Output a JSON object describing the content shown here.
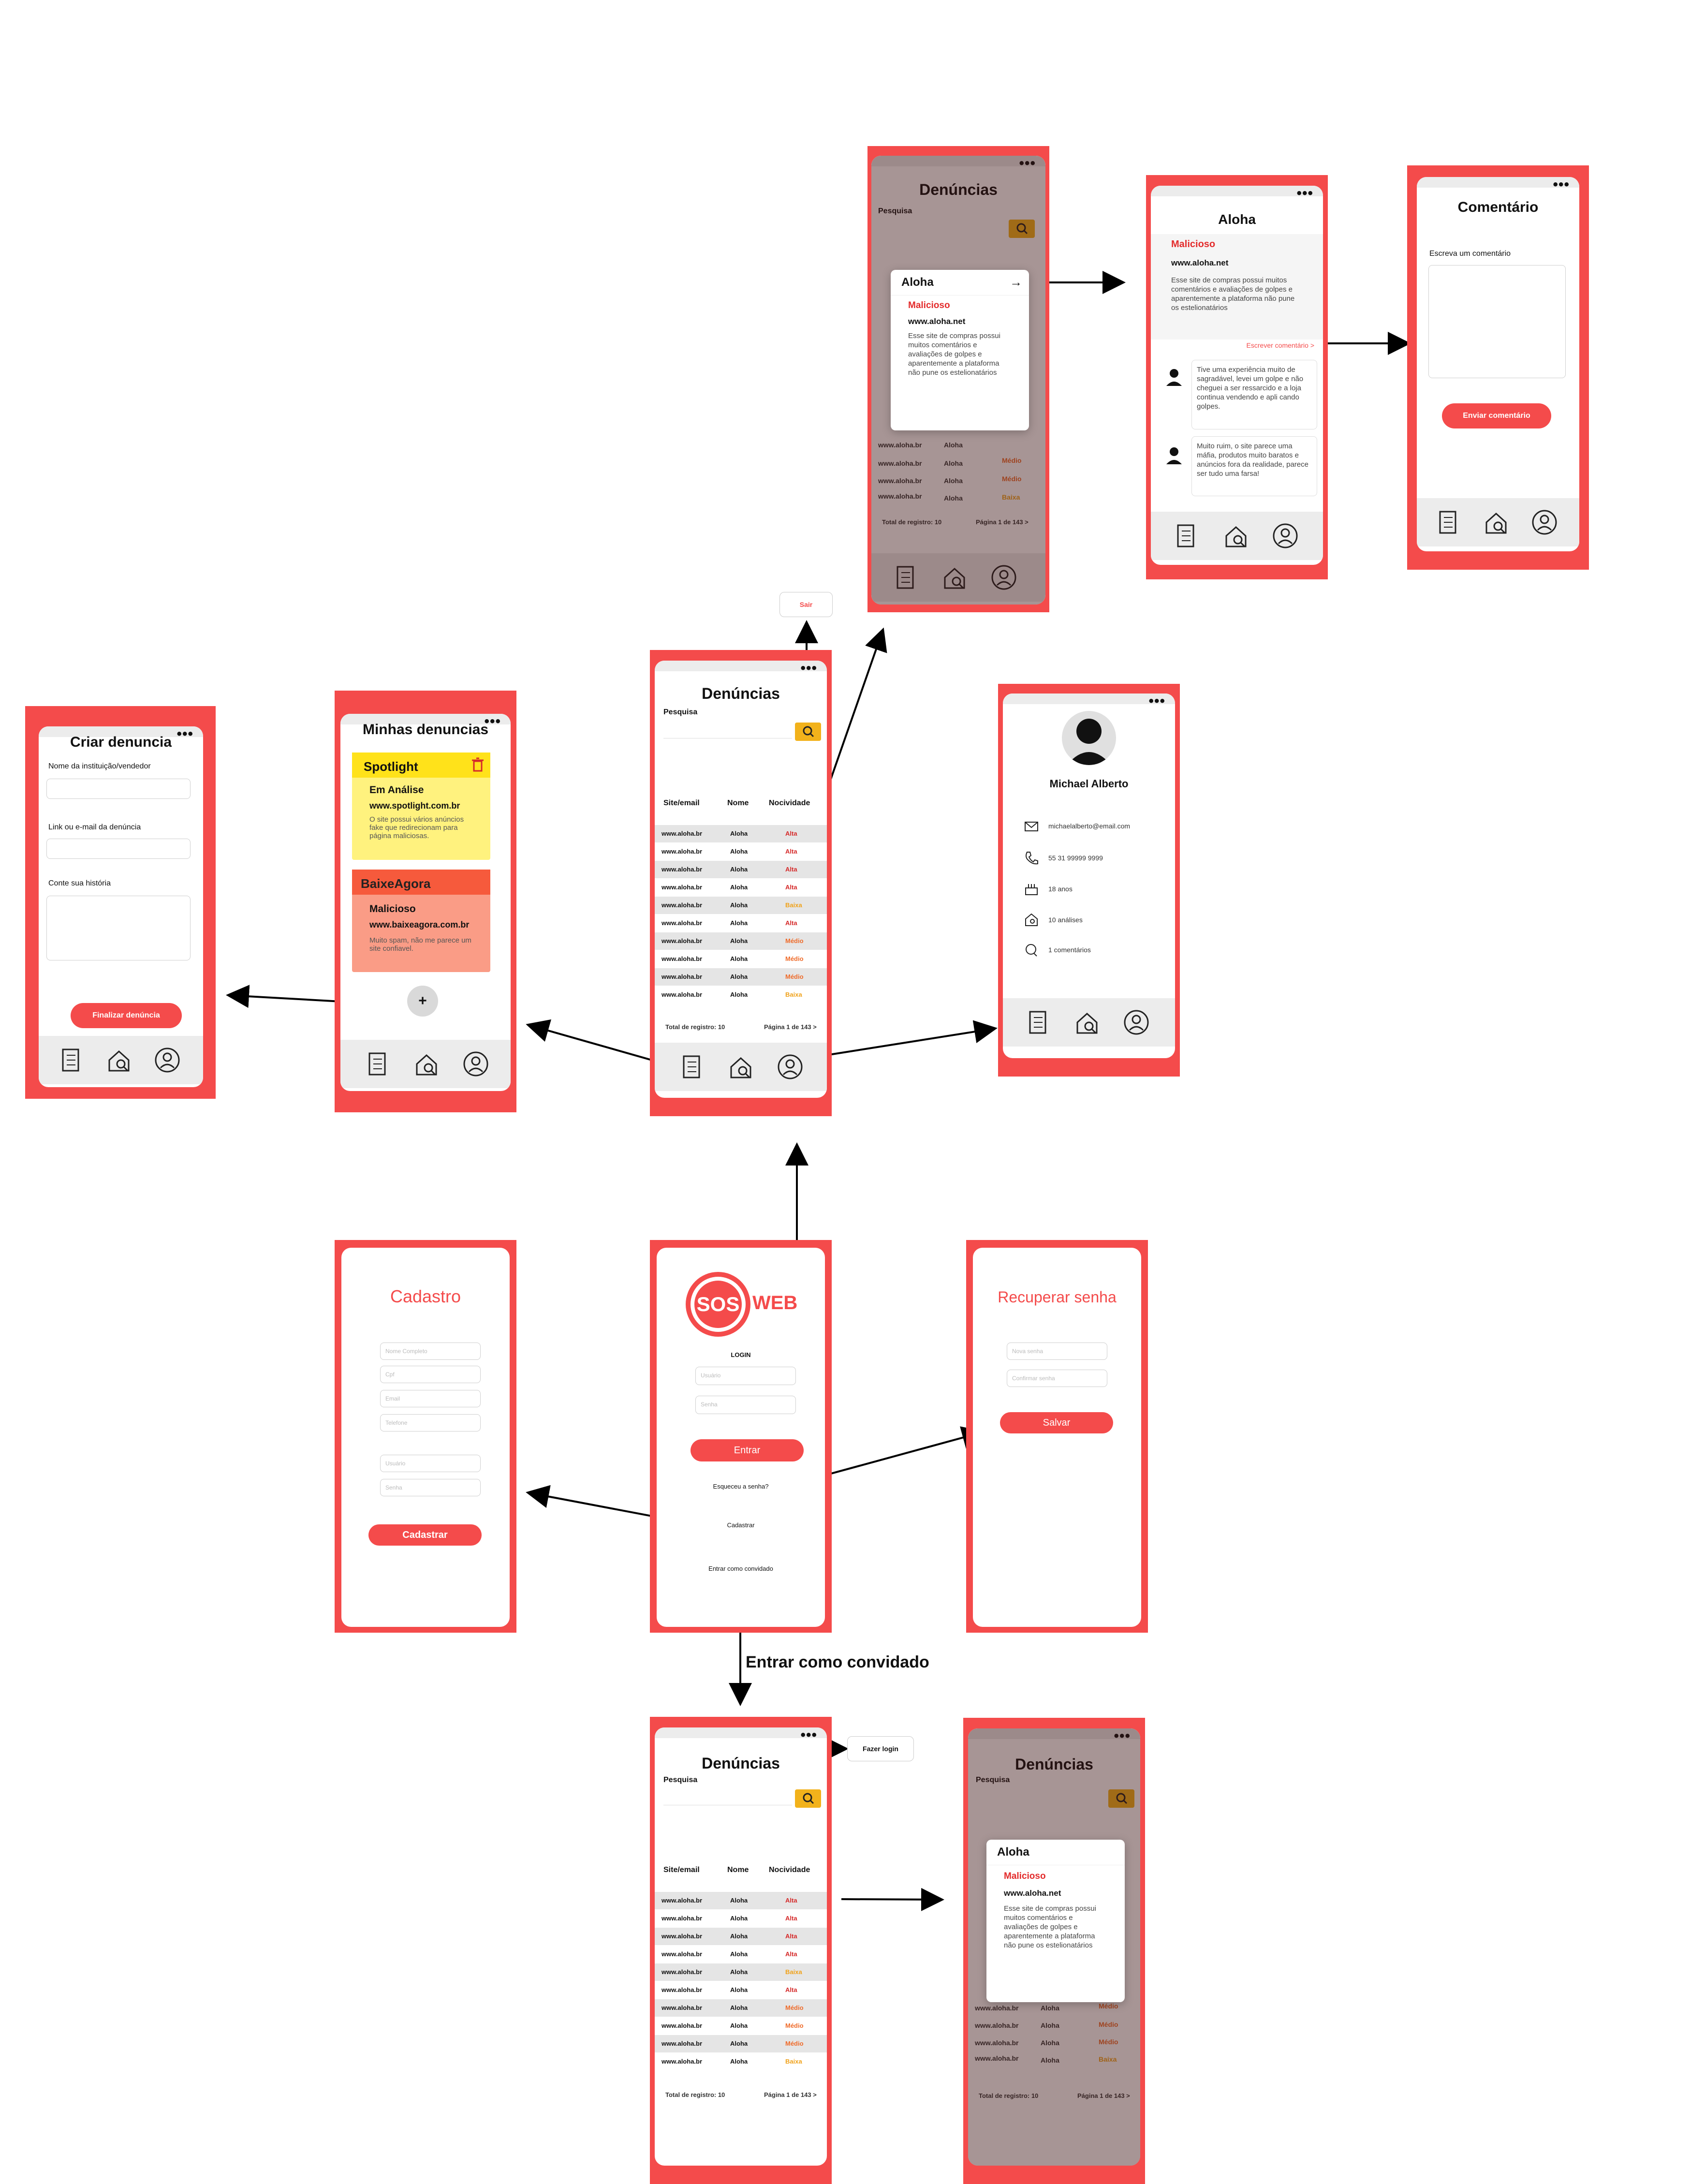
{
  "colors": {
    "brand_red": "#f44b4b",
    "search_yellow": "#f2b21b",
    "alta": "#d52a2a",
    "medio": "#ef6b2a",
    "baixa": "#f0a21b"
  },
  "denuncias": {
    "title": "Denúncias",
    "search_label": "Pesquisa",
    "columns": [
      "Site/email",
      "Nome",
      "Nocividade"
    ],
    "rows": [
      {
        "site": "www.aloha.br",
        "nome": "Aloha",
        "nivel": "Alta"
      },
      {
        "site": "www.aloha.br",
        "nome": "Aloha",
        "nivel": "Alta"
      },
      {
        "site": "www.aloha.br",
        "nome": "Aloha",
        "nivel": "Alta"
      },
      {
        "site": "www.aloha.br",
        "nome": "Aloha",
        "nivel": "Alta"
      },
      {
        "site": "www.aloha.br",
        "nome": "Aloha",
        "nivel": "Baixa"
      },
      {
        "site": "www.aloha.br",
        "nome": "Aloha",
        "nivel": "Alta"
      },
      {
        "site": "www.aloha.br",
        "nome": "Aloha",
        "nivel": "Médio"
      },
      {
        "site": "www.aloha.br",
        "nome": "Aloha",
        "nivel": "Médio"
      },
      {
        "site": "www.aloha.br",
        "nome": "Aloha",
        "nivel": "Médio"
      },
      {
        "site": "www.aloha.br",
        "nome": "Aloha",
        "nivel": "Baixa"
      }
    ],
    "total": "Total de registro: 10",
    "pagina": "Página 1 de 143  >"
  },
  "popup": {
    "title": "Aloha",
    "tag": "Malicioso",
    "site": "www.aloha.net",
    "desc": "Esse site de compras possui muitos comentários e avaliações de golpes e aparentemente a plataforma não pune os estelionatários"
  },
  "detalhe": {
    "title": "Aloha",
    "tag": "Malicioso",
    "site": "www.aloha.net",
    "desc": "Esse site de compras possui muitos comentários e avaliações de golpes e aparentemente a plataforma não pune os estelionatários",
    "escrever": "Escrever comentário >",
    "comments": [
      "Tive uma experiência muito de sagradável, levei um golpe e não cheguei a ser ressarcido e a loja continua vendendo e apli cando golpes.",
      "Muito ruim, o site parece uma máfia, produtos muito baratos e anúncios fora da realidade, parece ser tudo uma farsa!"
    ]
  },
  "comentario": {
    "title": "Comentário",
    "label": "Escreva um comentário",
    "button": "Enviar comentário"
  },
  "sair": "Sair",
  "perfil": {
    "name": "Michael Alberto",
    "email": "michaelalberto@email.com",
    "phone": "55 31 99999 9999",
    "age": "18 anos",
    "analises": "10 análises",
    "comentarios": "1 comentários"
  },
  "minhas": {
    "title": "Minhas denuncias",
    "cards": [
      {
        "name": "Spotlight",
        "status": "Em Análise",
        "site": "www.spotlight.com.br",
        "desc": "O site possui vários anúncios fake que redirecionam para página maliciosas."
      },
      {
        "name": "BaixeAgora",
        "status": "Malicioso",
        "site": "www.baixeagora.com.br",
        "desc": "Muito spam, não me parece um site confiavel."
      }
    ],
    "add": "+"
  },
  "criar": {
    "title": "Criar denuncia",
    "f1": "Nome da instituição/vendedor",
    "f2": "Link ou e-mail da denúncia",
    "f3": "Conte sua história",
    "button": "Finalizar denúncia"
  },
  "login": {
    "logo_sos": "SOS",
    "logo_web": "WEB",
    "label": "LOGIN",
    "user_ph": "Usuário",
    "pass_ph": "Senha",
    "button": "Entrar",
    "forgot": "Esqueceu a senha?",
    "register": "Cadastrar",
    "guest": "Entrar como convidado"
  },
  "cadastro": {
    "title": "Cadastro",
    "fields": [
      "Nome Completo",
      "Cpf",
      "Email",
      "Telefone",
      "Usuário",
      "Senha"
    ],
    "button": "Cadastrar"
  },
  "recuperar": {
    "title": "Recuperar senha",
    "fields": [
      "Nova senha",
      "Confirmar senha"
    ],
    "button": "Salvar"
  },
  "guest_annotation": "Entrar como convidado",
  "fazer_login": "Fazer login"
}
